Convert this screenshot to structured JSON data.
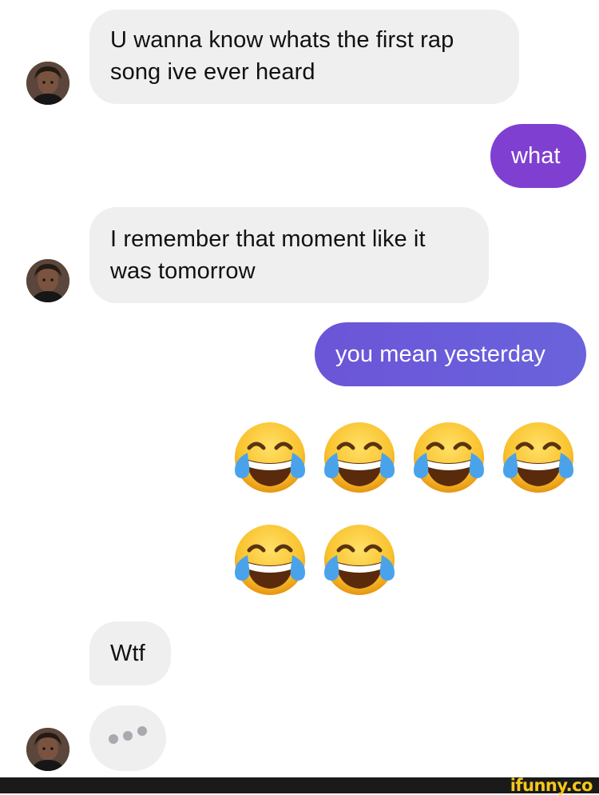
{
  "messages": [
    {
      "side": "incoming",
      "text": "U wanna know whats the first rap song ive ever heard"
    },
    {
      "side": "outgoing",
      "text": "what"
    },
    {
      "side": "incoming",
      "text": "I remember that moment like it was tomorrow"
    },
    {
      "side": "outgoing",
      "text": "you mean yesterday"
    },
    {
      "side": "outgoing",
      "emoji": "face-with-tears-of-joy",
      "count": 6
    },
    {
      "side": "incoming",
      "text": "Wtf"
    },
    {
      "side": "incoming",
      "typing": true
    }
  ],
  "msg1": "U wanna know whats the first rap",
  "msg1b": "song ive ever heard",
  "msg2": "what",
  "msg3": "I remember that moment like it",
  "msg3b": "was tomorrow",
  "msg4": "you mean yesterday",
  "msg5": "Wtf",
  "watermark": "ifunny.co",
  "colors": {
    "incoming_bubble": "#efefef",
    "outgoing_purple": "#7f3fd0",
    "outgoing_gradient_start": "#6b55d8",
    "outgoing_gradient_end": "#6a63db",
    "watermark": "#f5c71a"
  }
}
